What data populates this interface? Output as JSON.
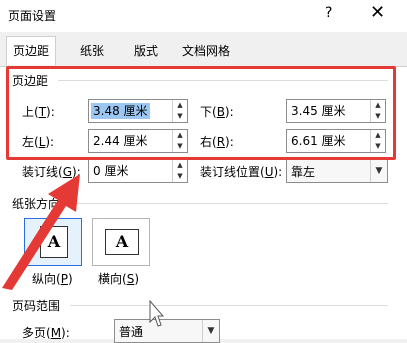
{
  "window": {
    "title": "页面设置",
    "help_icon": "?",
    "close_icon": "✕"
  },
  "tabs": [
    "页边距",
    "纸张",
    "版式",
    "文档网格"
  ],
  "margins": {
    "section_title": "页边距",
    "top": {
      "label_prefix": "上(",
      "hotkey": "T",
      "label_suffix": "):",
      "value": "3.48 厘米"
    },
    "bottom": {
      "label_prefix": "下(",
      "hotkey": "B",
      "label_suffix": "):",
      "value": "3.45 厘米"
    },
    "left": {
      "label_prefix": "左(",
      "hotkey": "L",
      "label_suffix": "):",
      "value": "2.44 厘米"
    },
    "right": {
      "label_prefix": "右(",
      "hotkey": "R",
      "label_suffix": "):",
      "value": "6.61 厘米"
    },
    "gutter": {
      "label_prefix": "装订线(",
      "hotkey": "G",
      "label_suffix": "):",
      "value": "0 厘米"
    },
    "gutter_pos": {
      "label_prefix": "装订线位置(",
      "hotkey": "U",
      "label_suffix": "):",
      "value": "靠左"
    }
  },
  "orientation": {
    "section_title": "纸张方向",
    "portrait": {
      "label_prefix": "纵向(",
      "hotkey": "P",
      "label_suffix": ")",
      "glyph": "A"
    },
    "landscape": {
      "label_prefix": "横向(",
      "hotkey": "S",
      "label_suffix": ")",
      "glyph": "A"
    }
  },
  "pages": {
    "section_title": "页码范围",
    "multi_label_prefix": "多页(",
    "multi_hotkey": "M",
    "multi_label_suffix": "):",
    "multi_value": "普通"
  },
  "colors": {
    "highlight": "#e53935",
    "selection": "#9bc7f2"
  }
}
